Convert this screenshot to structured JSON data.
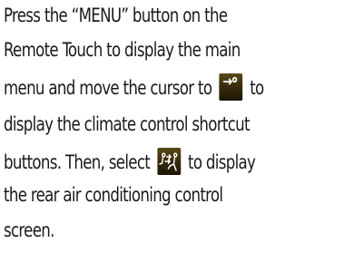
{
  "paragraph": {
    "line1": "Press the “MENU” button on the",
    "line2": "Remote Touch to display the main",
    "line3_before": "menu and move the cursor to",
    "line3_after": "to",
    "line4": "display the climate control shortcut",
    "line5_before": "buttons. Then, select",
    "line5_after": "to display",
    "line6": "the rear air conditioning control",
    "line7": "screen."
  },
  "icons": {
    "climate": "climate-seat-airflow-icon",
    "rear_air": "rear-seat-airflow-icon"
  },
  "colors": {
    "text": "#1a1a1a",
    "icon_bg": "#3a2e0c",
    "icon_fg": "#ffffff"
  }
}
